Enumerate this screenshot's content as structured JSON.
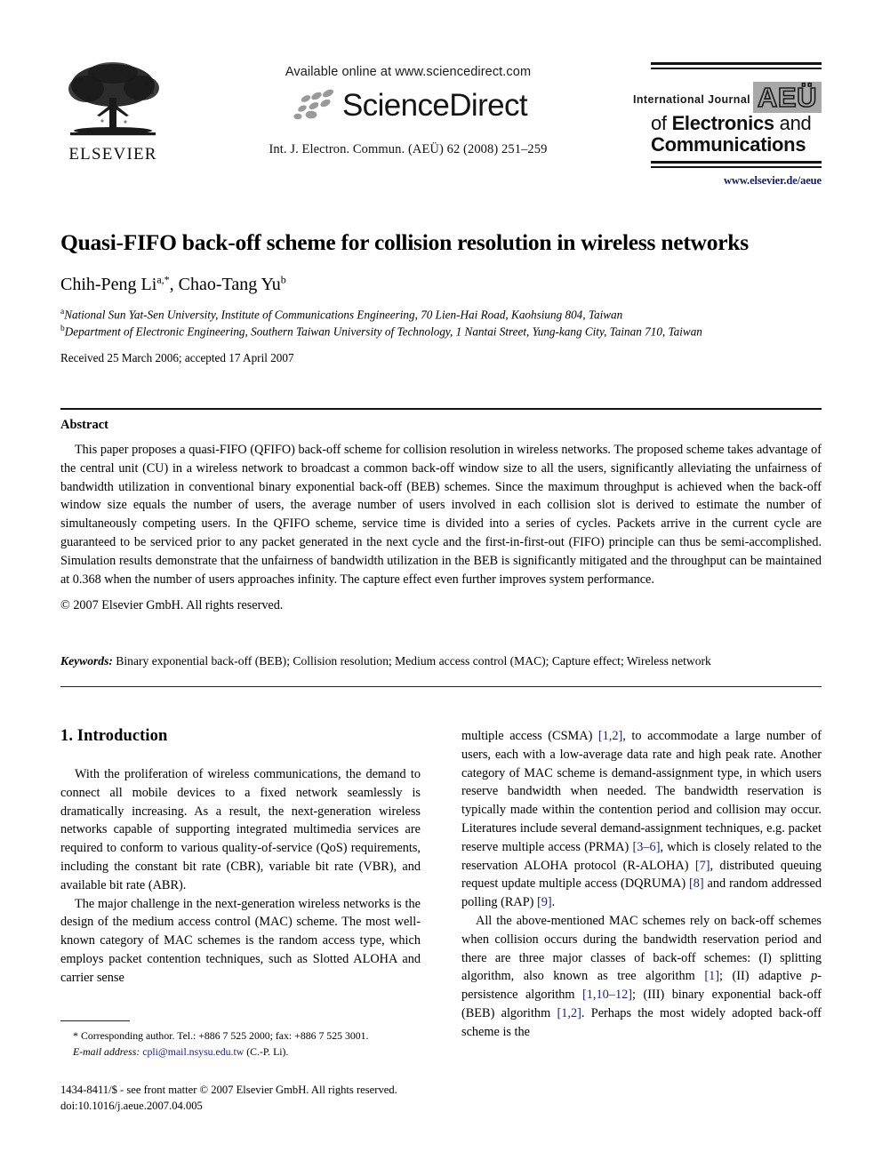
{
  "masthead": {
    "publisher_name": "ELSEVIER",
    "available_online": "Available online at www.sciencedirect.com",
    "sciencedirect_wordmark": "ScienceDirect",
    "journal_citation": "Int. J. Electron. Commun. (AEÜ) 62 (2008) 251–259",
    "journal_logo": {
      "line_intl": "International Journal",
      "badge": "AEÜ",
      "line2_prefix": "of ",
      "line2_bold": "Electronics",
      "line2_suffix": " and",
      "line3_bold": "Communications"
    },
    "journal_url": "www.elsevier.de/aeue"
  },
  "article": {
    "title": "Quasi-FIFO back-off scheme for collision resolution in wireless networks",
    "authors_html": "Chih-Peng Li<sup>a,*</sup>, Chao-Tang Yu<sup>b</sup>",
    "affiliation_a": "National Sun Yat-Sen University, Institute of Communications Engineering, 70 Lien-Hai Road, Kaohsiung 804, Taiwan",
    "affiliation_b": "Department of Electronic Engineering, Southern Taiwan University of Technology, 1 Nantai Street, Yung-kang City, Tainan 710, Taiwan",
    "affiliation_a_marker": "a",
    "affiliation_b_marker": "b",
    "received_line": "Received 25 March 2006; accepted 17 April 2007"
  },
  "abstract": {
    "heading": "Abstract",
    "body": "This paper proposes a quasi-FIFO (QFIFO) back-off scheme for collision resolution in wireless networks. The proposed scheme takes advantage of the central unit (CU) in a wireless network to broadcast a common back-off window size to all the users, significantly alleviating the unfairness of bandwidth utilization in conventional binary exponential back-off (BEB) schemes. Since the maximum throughput is achieved when the back-off window size equals the number of users, the average number of users involved in each collision slot is derived to estimate the number of simultaneously competing users. In the QFIFO scheme, service time is divided into a series of cycles. Packets arrive in the current cycle are guaranteed to be serviced prior to any packet generated in the next cycle and the first-in-first-out (FIFO) principle can thus be semi-accomplished. Simulation results demonstrate that the unfairness of bandwidth utilization in the BEB is significantly mitigated and the throughput can be maintained at 0.368 when the number of users approaches infinity. The capture effect even further improves system performance.",
    "copyright": "© 2007 Elsevier GmbH. All rights reserved.",
    "keywords_label": "Keywords:",
    "keywords_value": " Binary exponential back-off (BEB); Collision resolution; Medium access control (MAC); Capture effect; Wireless network"
  },
  "body": {
    "section_number_title": "1.  Introduction",
    "left_paragraph_1": "With the proliferation of wireless communications, the demand to connect all mobile devices to a fixed network seamlessly is dramatically increasing. As a result, the next-generation wireless networks capable of supporting integrated multimedia services are required to conform to various quality-of-service (QoS) requirements, including the constant bit rate (CBR), variable bit rate (VBR), and available bit rate (ABR).",
    "left_paragraph_2": "The major challenge in the next-generation wireless networks is the design of the medium access control (MAC) scheme. The most well-known category of MAC schemes is the random access type, which employs packet contention techniques, such as Slotted ALOHA and carrier sense",
    "right_paragraph_1_a": "multiple access (CSMA) ",
    "right_cite_1": "[1,2]",
    "right_paragraph_1_b": ", to accommodate a large number of users, each with a low-average data rate and high peak rate. Another category of MAC scheme is demand-assignment type, in which users reserve bandwidth when needed. The bandwidth reservation is typically made within the contention period and collision may occur. Literatures include several demand-assignment techniques, e.g. packet reserve multiple access (PRMA) ",
    "right_cite_2": "[3–6]",
    "right_paragraph_1_c": ", which is closely related to the reservation ALOHA protocol (R-ALOHA) ",
    "right_cite_3": "[7]",
    "right_paragraph_1_d": ", distributed queuing request update multiple access (DQRUMA) ",
    "right_cite_4": "[8]",
    "right_paragraph_1_e": " and random addressed polling (RAP) ",
    "right_cite_5": "[9]",
    "right_paragraph_1_f": ".",
    "right_paragraph_2_a": "All the above-mentioned MAC schemes rely on back-off schemes when collision occurs during the bandwidth reservation period and there are three major classes of back-off schemes: (I) splitting algorithm, also known as tree algorithm ",
    "right_cite_6": "[1]",
    "right_paragraph_2_b": "; (II) adaptive ",
    "right_italic_p": "p",
    "right_paragraph_2_c": "-persistence algorithm ",
    "right_cite_7": "[1,10–12]",
    "right_paragraph_2_d": "; (III) binary exponential back-off (BEB) algorithm ",
    "right_cite_8": "[1,2]",
    "right_paragraph_2_e": ". Perhaps the most widely adopted back-off scheme is the"
  },
  "footnotes": {
    "corresponding_marker": "*",
    "corresponding_text": " Corresponding author. Tel.: +886 7 525 2000; fax: +886 7 525 3001.",
    "email_label": "E-mail address:",
    "email_value": " cpli@mail.nsysu.edu.tw",
    "email_suffix": " (C.-P. Li).",
    "imprint_line1": "1434-8411/$ - see front matter © 2007 Elsevier GmbH. All rights reserved.",
    "imprint_line2": "doi:10.1016/j.aeue.2007.04.005"
  },
  "colors": {
    "link_blue": "#1a237e",
    "badge_gray": "#a8a8a8",
    "text_black": "#000000"
  }
}
